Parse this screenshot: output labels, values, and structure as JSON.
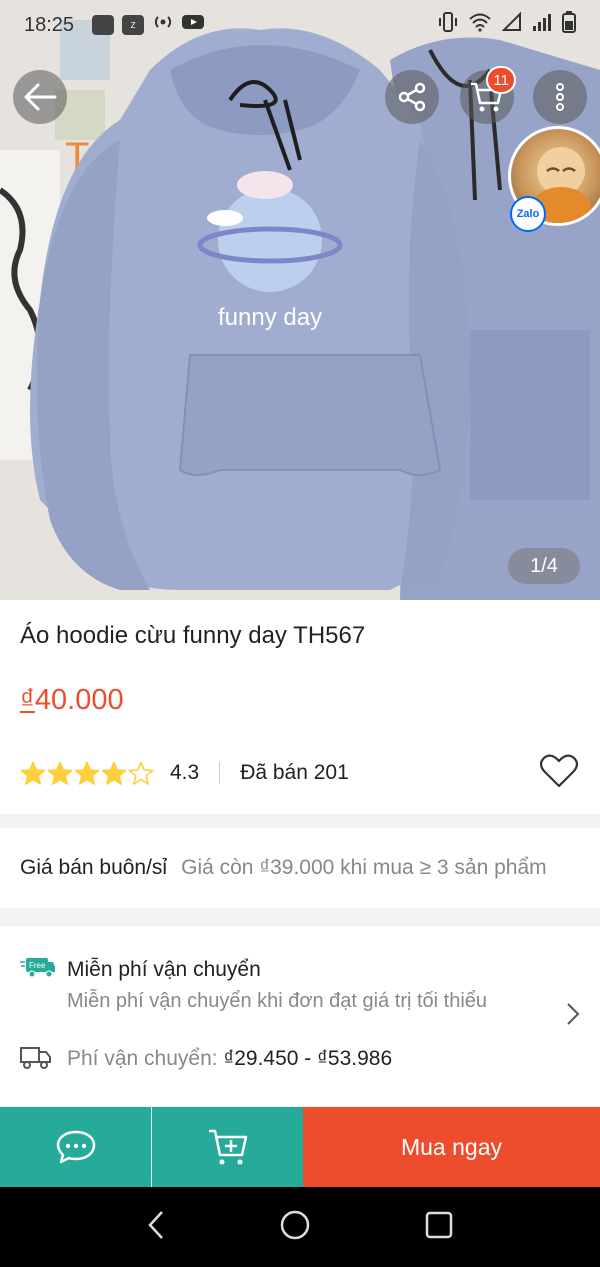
{
  "status_bar": {
    "time": "18:25",
    "left_icons": [
      "notification-icon",
      "zalo-notification-icon",
      "hotspot-icon",
      "youtube-icon"
    ],
    "right_icons": [
      "vibrate-icon",
      "wifi-icon",
      "signal-icon",
      "signal-icon",
      "battery-icon"
    ]
  },
  "image_overlay": {
    "cart_count": "11",
    "zalo_label": "Zalo",
    "counter": "1/4",
    "print_text": "funny day"
  },
  "product": {
    "title": "Áo hoodie cừu funny day TH567",
    "price_currency": "₫",
    "price_value": "40.000",
    "rating": "4.3",
    "rating_stars": 4.3,
    "sold": "Đã bán 201"
  },
  "wholesale": {
    "label": "Giá bán buôn/sỉ",
    "value": "Giá còn ₫39.000 khi mua ≥ 3 sản phẩm"
  },
  "shipping": {
    "free_tag": "Free",
    "title": "Miễn phí vận chuyển",
    "subtitle": "Miễn phí vận chuyển khi đơn đạt giá trị tối thiểu",
    "fee_label": "Phí vận chuyển:",
    "fee_range": "₫29.450 - ₫53.986"
  },
  "action_bar": {
    "buy_label": "Mua ngay"
  },
  "colors": {
    "accent": "#ee4d2d",
    "teal": "#26aa99",
    "star": "#ffce3d"
  }
}
